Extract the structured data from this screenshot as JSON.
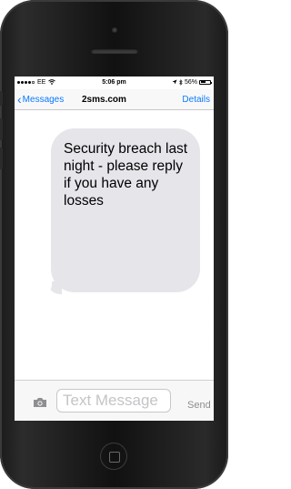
{
  "status_bar": {
    "carrier": "EE",
    "time": "5:06 pm",
    "battery": "56%",
    "battery_level": 0.56
  },
  "nav": {
    "back_label": "Messages",
    "title": "2sms.com",
    "details_label": "Details"
  },
  "message": {
    "text": "Security breach last night - please reply if you have any losses"
  },
  "compose": {
    "placeholder": "Text Message",
    "send_label": "Send"
  }
}
